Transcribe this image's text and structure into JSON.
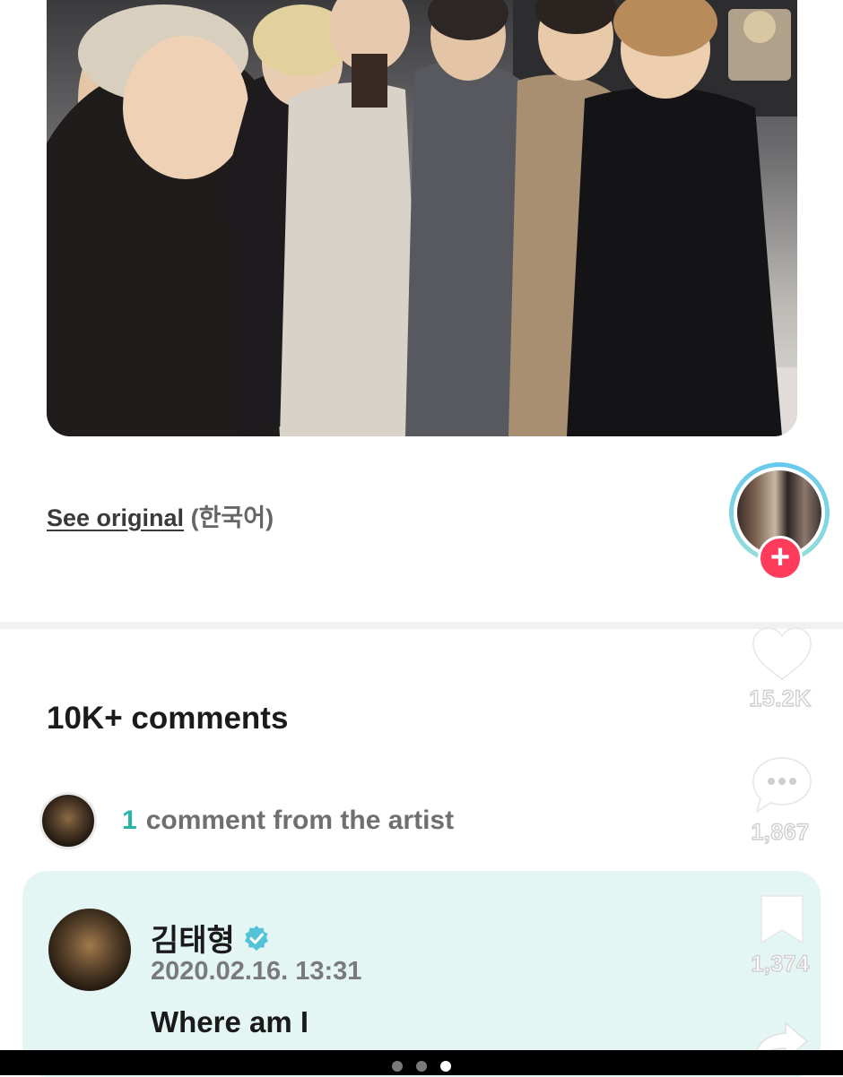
{
  "post": {
    "photo_alt": "",
    "see_original": "See original",
    "language": "(한국어)"
  },
  "comments": {
    "title": "10K+ comments",
    "artist_count": "1",
    "artist_label": "comment from the artist"
  },
  "artist_comment": {
    "name": "김태형",
    "timestamp": "2020.02.16. 13:31",
    "text": "Where am I"
  },
  "rail": {
    "likes": "15.2K",
    "comments": "1,867",
    "saves": "1,374",
    "follow_symbol": "+",
    "icons": [
      "heart-icon",
      "comment-bubble-icon",
      "bookmark-icon",
      "share-arrow-icon"
    ]
  },
  "pager": {
    "total": 3,
    "active": 3
  },
  "colors": {
    "accent_teal": "#2bb3a6",
    "card_bg": "#e3f6f4",
    "follow_red": "#ff3b5c",
    "verified_blue": "#55c3d7"
  }
}
